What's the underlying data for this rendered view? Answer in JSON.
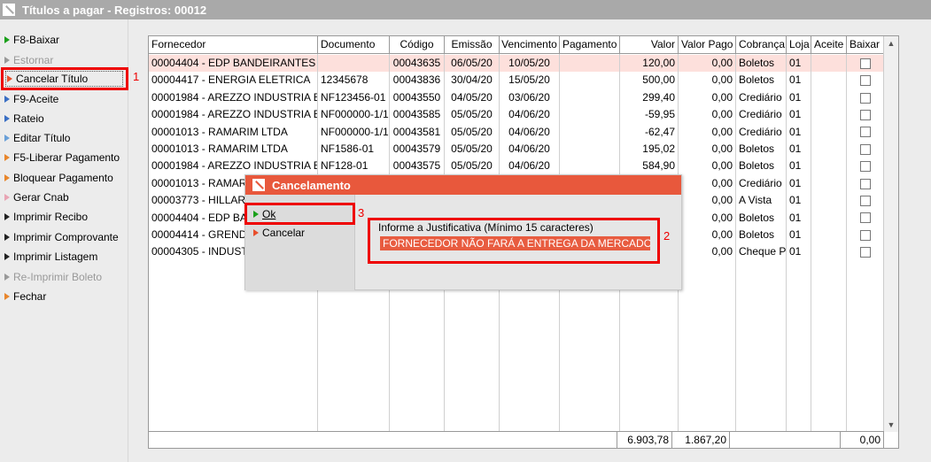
{
  "window": {
    "title": "Títulos a pagar - Registros: 00012"
  },
  "sidebar": {
    "items": [
      {
        "label": "F8-Baixar",
        "icon": "green-triangle-icon",
        "enabled": true
      },
      {
        "label": "Estornar",
        "icon": "gray-triangle-icon",
        "enabled": false
      },
      {
        "label": "Cancelar Título",
        "icon": "red-triangle-icon",
        "enabled": true
      },
      {
        "label": "F9-Aceite",
        "icon": "blue-triangle-icon",
        "enabled": true
      },
      {
        "label": "Rateio",
        "icon": "blue-triangle-icon",
        "enabled": true
      },
      {
        "label": "Editar Título",
        "icon": "lightblue-triangle-icon",
        "enabled": true
      },
      {
        "label": "F5-Liberar Pagamento",
        "icon": "orange-triangle-icon",
        "enabled": true
      },
      {
        "label": "Bloquear Pagamento",
        "icon": "orange-triangle-icon",
        "enabled": true
      },
      {
        "label": "Gerar Cnab",
        "icon": "pink-triangle-icon",
        "enabled": true
      },
      {
        "label": "Imprimir Recibo",
        "icon": "dark-triangle-icon",
        "enabled": true
      },
      {
        "label": "Imprimir Comprovante",
        "icon": "dark-triangle-icon",
        "enabled": true
      },
      {
        "label": "Imprimir Listagem",
        "icon": "dark-triangle-icon",
        "enabled": true
      },
      {
        "label": "Re-Imprimir Boleto",
        "icon": "gray-triangle-icon",
        "enabled": false
      },
      {
        "label": "Fechar",
        "icon": "orange-triangle-icon",
        "enabled": true
      }
    ]
  },
  "annotations": {
    "one": "1",
    "two": "2",
    "three": "3"
  },
  "grid": {
    "columns": [
      "Fornecedor",
      "Documento",
      "Código",
      "Emissão",
      "Vencimento",
      "Pagamento",
      "Valor",
      "Valor Pago",
      "Cobrança",
      "Loja",
      "Aceite",
      "Baixar"
    ],
    "rows": [
      [
        "00004404 - EDP BANDEIRANTES",
        "",
        "00043635",
        "06/05/20",
        "10/05/20",
        "",
        "120,00",
        "0,00",
        "Boletos",
        "01",
        "",
        ""
      ],
      [
        "00004417 - ENERGIA ELETRICA",
        "12345678",
        "00043836",
        "30/04/20",
        "15/05/20",
        "",
        "500,00",
        "0,00",
        "Boletos",
        "01",
        "",
        ""
      ],
      [
        "00001984 - AREZZO INDUSTRIA E C",
        "NF123456-01",
        "00043550",
        "04/05/20",
        "03/06/20",
        "",
        "299,40",
        "0,00",
        "Crediário",
        "01",
        "",
        ""
      ],
      [
        "00001984 - AREZZO INDUSTRIA E C",
        "NF000000-1/1",
        "00043585",
        "05/05/20",
        "04/06/20",
        "",
        "-59,95",
        "0,00",
        "Crediário",
        "01",
        "",
        ""
      ],
      [
        "00001013 - RAMARIM LTDA",
        "NF000000-1/1",
        "00043581",
        "05/05/20",
        "04/06/20",
        "",
        "-62,47",
        "0,00",
        "Crediário",
        "01",
        "",
        ""
      ],
      [
        "00001013 - RAMARIM LTDA",
        "NF1586-01",
        "00043579",
        "05/05/20",
        "04/06/20",
        "",
        "195,02",
        "0,00",
        "Boletos",
        "01",
        "",
        ""
      ],
      [
        "00001984 - AREZZO INDUSTRIA E C",
        "NF128-01",
        "00043575",
        "05/05/20",
        "04/06/20",
        "",
        "584,90",
        "0,00",
        "Boletos",
        "01",
        "",
        ""
      ],
      [
        "00001013 - RAMARI",
        "",
        "",
        "",
        "",
        "",
        "",
        "0,00",
        "Crediário",
        "01",
        "",
        ""
      ],
      [
        "00003773 - HILLARY",
        "",
        "",
        "",
        "",
        "",
        "",
        "0,00",
        "A Vista",
        "01",
        "",
        ""
      ],
      [
        "00004404 - EDP BAN",
        "",
        "",
        "",
        "",
        "",
        "",
        "0,00",
        "Boletos",
        "01",
        "",
        ""
      ],
      [
        "00004414 - GRENDE",
        "",
        "",
        "",
        "",
        "",
        "",
        "0,00",
        "Boletos",
        "01",
        "",
        ""
      ],
      [
        "00004305 - INDUSTR",
        "",
        "",
        "",
        "",
        "",
        "",
        "0,00",
        "Cheque P",
        "01",
        "",
        ""
      ]
    ],
    "footer": {
      "valor_total": "6.903,78",
      "valor_pago_total": "1.867,20",
      "baixar_total": "0,00"
    }
  },
  "dialog": {
    "title": "Cancelamento",
    "ok_label": "Ok",
    "cancel_label": "Cancelar",
    "justification_label": "Informe a Justificativa (Mínimo 15 caracteres)",
    "justification_value": "FORNECEDOR NÃO FARÁ A ENTREGA DA MERCADORIA"
  },
  "colors": {
    "accent": "#e8583c",
    "annotation": "#ee0000",
    "selected_row": "#fde0dc"
  }
}
